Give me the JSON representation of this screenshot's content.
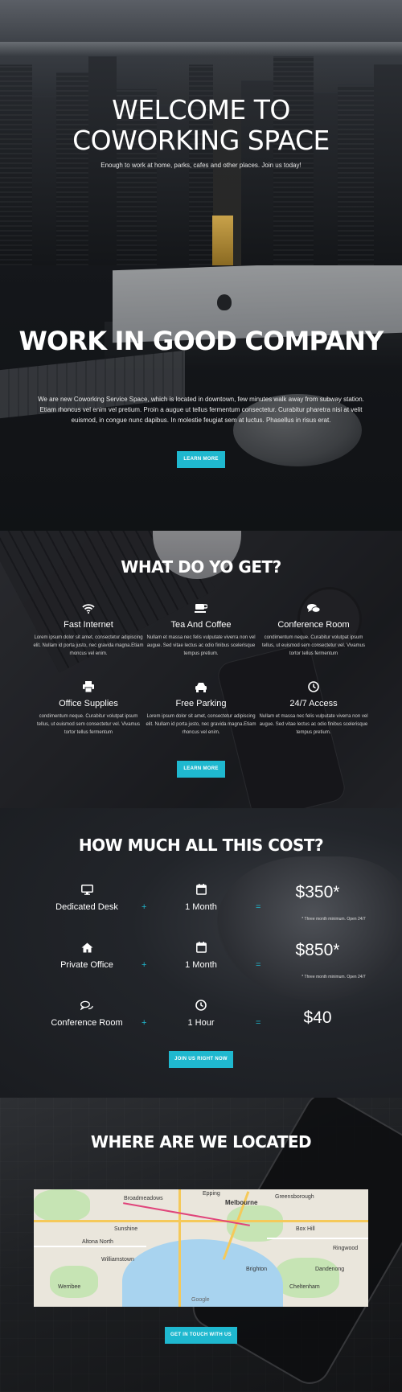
{
  "hero": {
    "title_line1": "WELCOME TO",
    "title_line2": "COWORKING SPACE",
    "subtitle": "Enough to work at home, parks, cafes and other places. Join us today!"
  },
  "company": {
    "title": "WORK IN GOOD COMPANY",
    "text": "We are new Coworking Service Space, which is located in downtown, few minutes walk away from subway station. Etiam rhoncus vel enim vel pretium. Proin a augue ut tellus fermentum consectetur. Curabitur pharetra nisi at velit euismod, in congue nunc dapibus. In molestie feugiat sem at luctus. Phasellus in risus erat.",
    "button": "LEARN MORE"
  },
  "features": {
    "title": "WHAT DO YO GET?",
    "button": "LEARN MORE",
    "items": [
      {
        "icon": "wifi-icon",
        "title": "Fast Internet",
        "text": "Lorem ipsum dolor sit amet, consectetur adipiscing elit. Nullam id porta justo, nec gravida magna.Etiam rhoncus vel enim."
      },
      {
        "icon": "coffee-icon",
        "title": "Tea And Coffee",
        "text": "Nullam et massa nec felis vulputate viverra non vel augue. Sed vitae lectus ac odio finibus scelerisque tempus pretium."
      },
      {
        "icon": "chat-icon",
        "title": "Conference Room",
        "text": "condimentum neque. Curabitur volutpat ipsum tellus, ut euismod sem consectetur vel. Vivamus tortor tellus fermentum"
      },
      {
        "icon": "printer-icon",
        "title": "Office Supplies",
        "text": "condimentum neque. Curabitur volutpat ipsum tellus, ut euismod sem consectetur vel. Vivamus tortor tellus fermentum"
      },
      {
        "icon": "car-icon",
        "title": "Free Parking",
        "text": "Lorem ipsum dolor sit amet, consectetur adipiscing elit. Nullam id porta justo, nec gravida magna.Etiam rhoncus vel enim."
      },
      {
        "icon": "clock-icon",
        "title": "24/7 Access",
        "text": "Nullam et massa nec felis vulputate viverra non vel augue. Sed vitae lectus ac odio finibus scelerisque tempus pretium."
      }
    ]
  },
  "pricing": {
    "title": "HOW MUCH ALL THIS COST?",
    "plus": "+",
    "equals": "=",
    "rows": [
      {
        "icon": "desktop-icon",
        "space": "Dedicated Desk",
        "duration_icon": "calendar-icon",
        "duration": "1 Month",
        "price": "$350*",
        "note": "* Three month minimum. Open 24/7"
      },
      {
        "icon": "home-icon",
        "space": "Private Office",
        "duration_icon": "calendar-icon",
        "duration": "1 Month",
        "price": "$850*",
        "note": "* Three month minimum. Open 24/7"
      },
      {
        "icon": "chat-icon",
        "space": "Conference Room",
        "duration_icon": "clock-icon",
        "duration": "1 Hour",
        "price": "$40",
        "note": ""
      }
    ],
    "button": "JOIN US RIGHT NOW"
  },
  "location": {
    "title": "WHERE ARE WE LOCATED",
    "map": {
      "city": "Melbourne",
      "labels": [
        "Broadmeadows",
        "Epping",
        "Greensborough",
        "Sunshine",
        "Box Hill",
        "Ringwood",
        "Altona North",
        "Williamstown",
        "Brighton",
        "Cheltenham",
        "Werribee",
        "Dandenong"
      ],
      "credit": "Google"
    },
    "button": "GET IN TOUCH WITH US"
  },
  "colors": {
    "accent": "#1fb8cf",
    "text": "#ffffff",
    "background": "#101114"
  }
}
